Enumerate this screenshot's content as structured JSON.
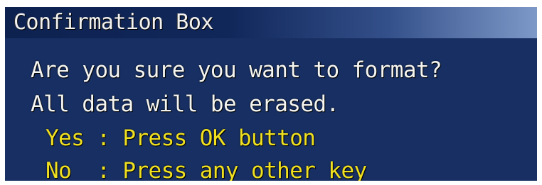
{
  "dialog": {
    "title": "Confirmation Box",
    "message_line1": "Are you sure you want to format?",
    "message_line2": "All data will be erased.",
    "option_yes": "Yes : Press OK button",
    "option_no": "No  : Press any other key"
  },
  "colors": {
    "background": "#172f63",
    "title_text": "#f1f1f1",
    "message_text": "#f4f4f0",
    "option_text": "#f0e020"
  }
}
